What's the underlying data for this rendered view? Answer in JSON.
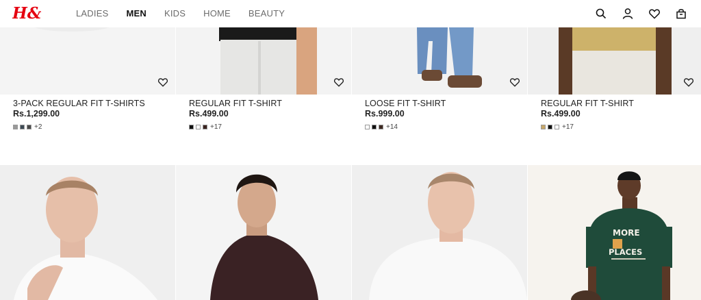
{
  "header": {
    "logo_text": "H&M",
    "nav": [
      {
        "label": "LADIES",
        "active": false
      },
      {
        "label": "MEN",
        "active": true
      },
      {
        "label": "KIDS",
        "active": false
      },
      {
        "label": "HOME",
        "active": false
      },
      {
        "label": "BEAUTY",
        "active": false
      }
    ],
    "icons": [
      "search-icon",
      "account-icon",
      "favorites-icon",
      "shopping-bag-icon"
    ]
  },
  "colors": {
    "brand_red": "#e50010",
    "text": "#222222",
    "nav_muted": "#6b6b6b"
  },
  "products": [
    {
      "name": "3-PACK REGULAR FIT T-SHIRTS",
      "price": "Rs.1,299.00",
      "swatches": [
        "#9a9a9a",
        "#3d4a55",
        "#4a4a4a"
      ],
      "more": "+2"
    },
    {
      "name": "REGULAR FIT T-SHIRT",
      "price": "Rs.499.00",
      "swatches": [
        "#111111",
        "#ffffff",
        "#3b2420"
      ],
      "more": "+17"
    },
    {
      "name": "LOOSE FIT T-SHIRT",
      "price": "Rs.999.00",
      "swatches": [
        "#ffffff",
        "#111111",
        "#3e2a22"
      ],
      "more": "+14"
    },
    {
      "name": "REGULAR FIT T-SHIRT",
      "price": "Rs.499.00",
      "swatches": [
        "#c8a86a",
        "#111111",
        "#ffffff"
      ],
      "more": "+17"
    }
  ],
  "row2_tshirt_print": "MORE PLACES"
}
